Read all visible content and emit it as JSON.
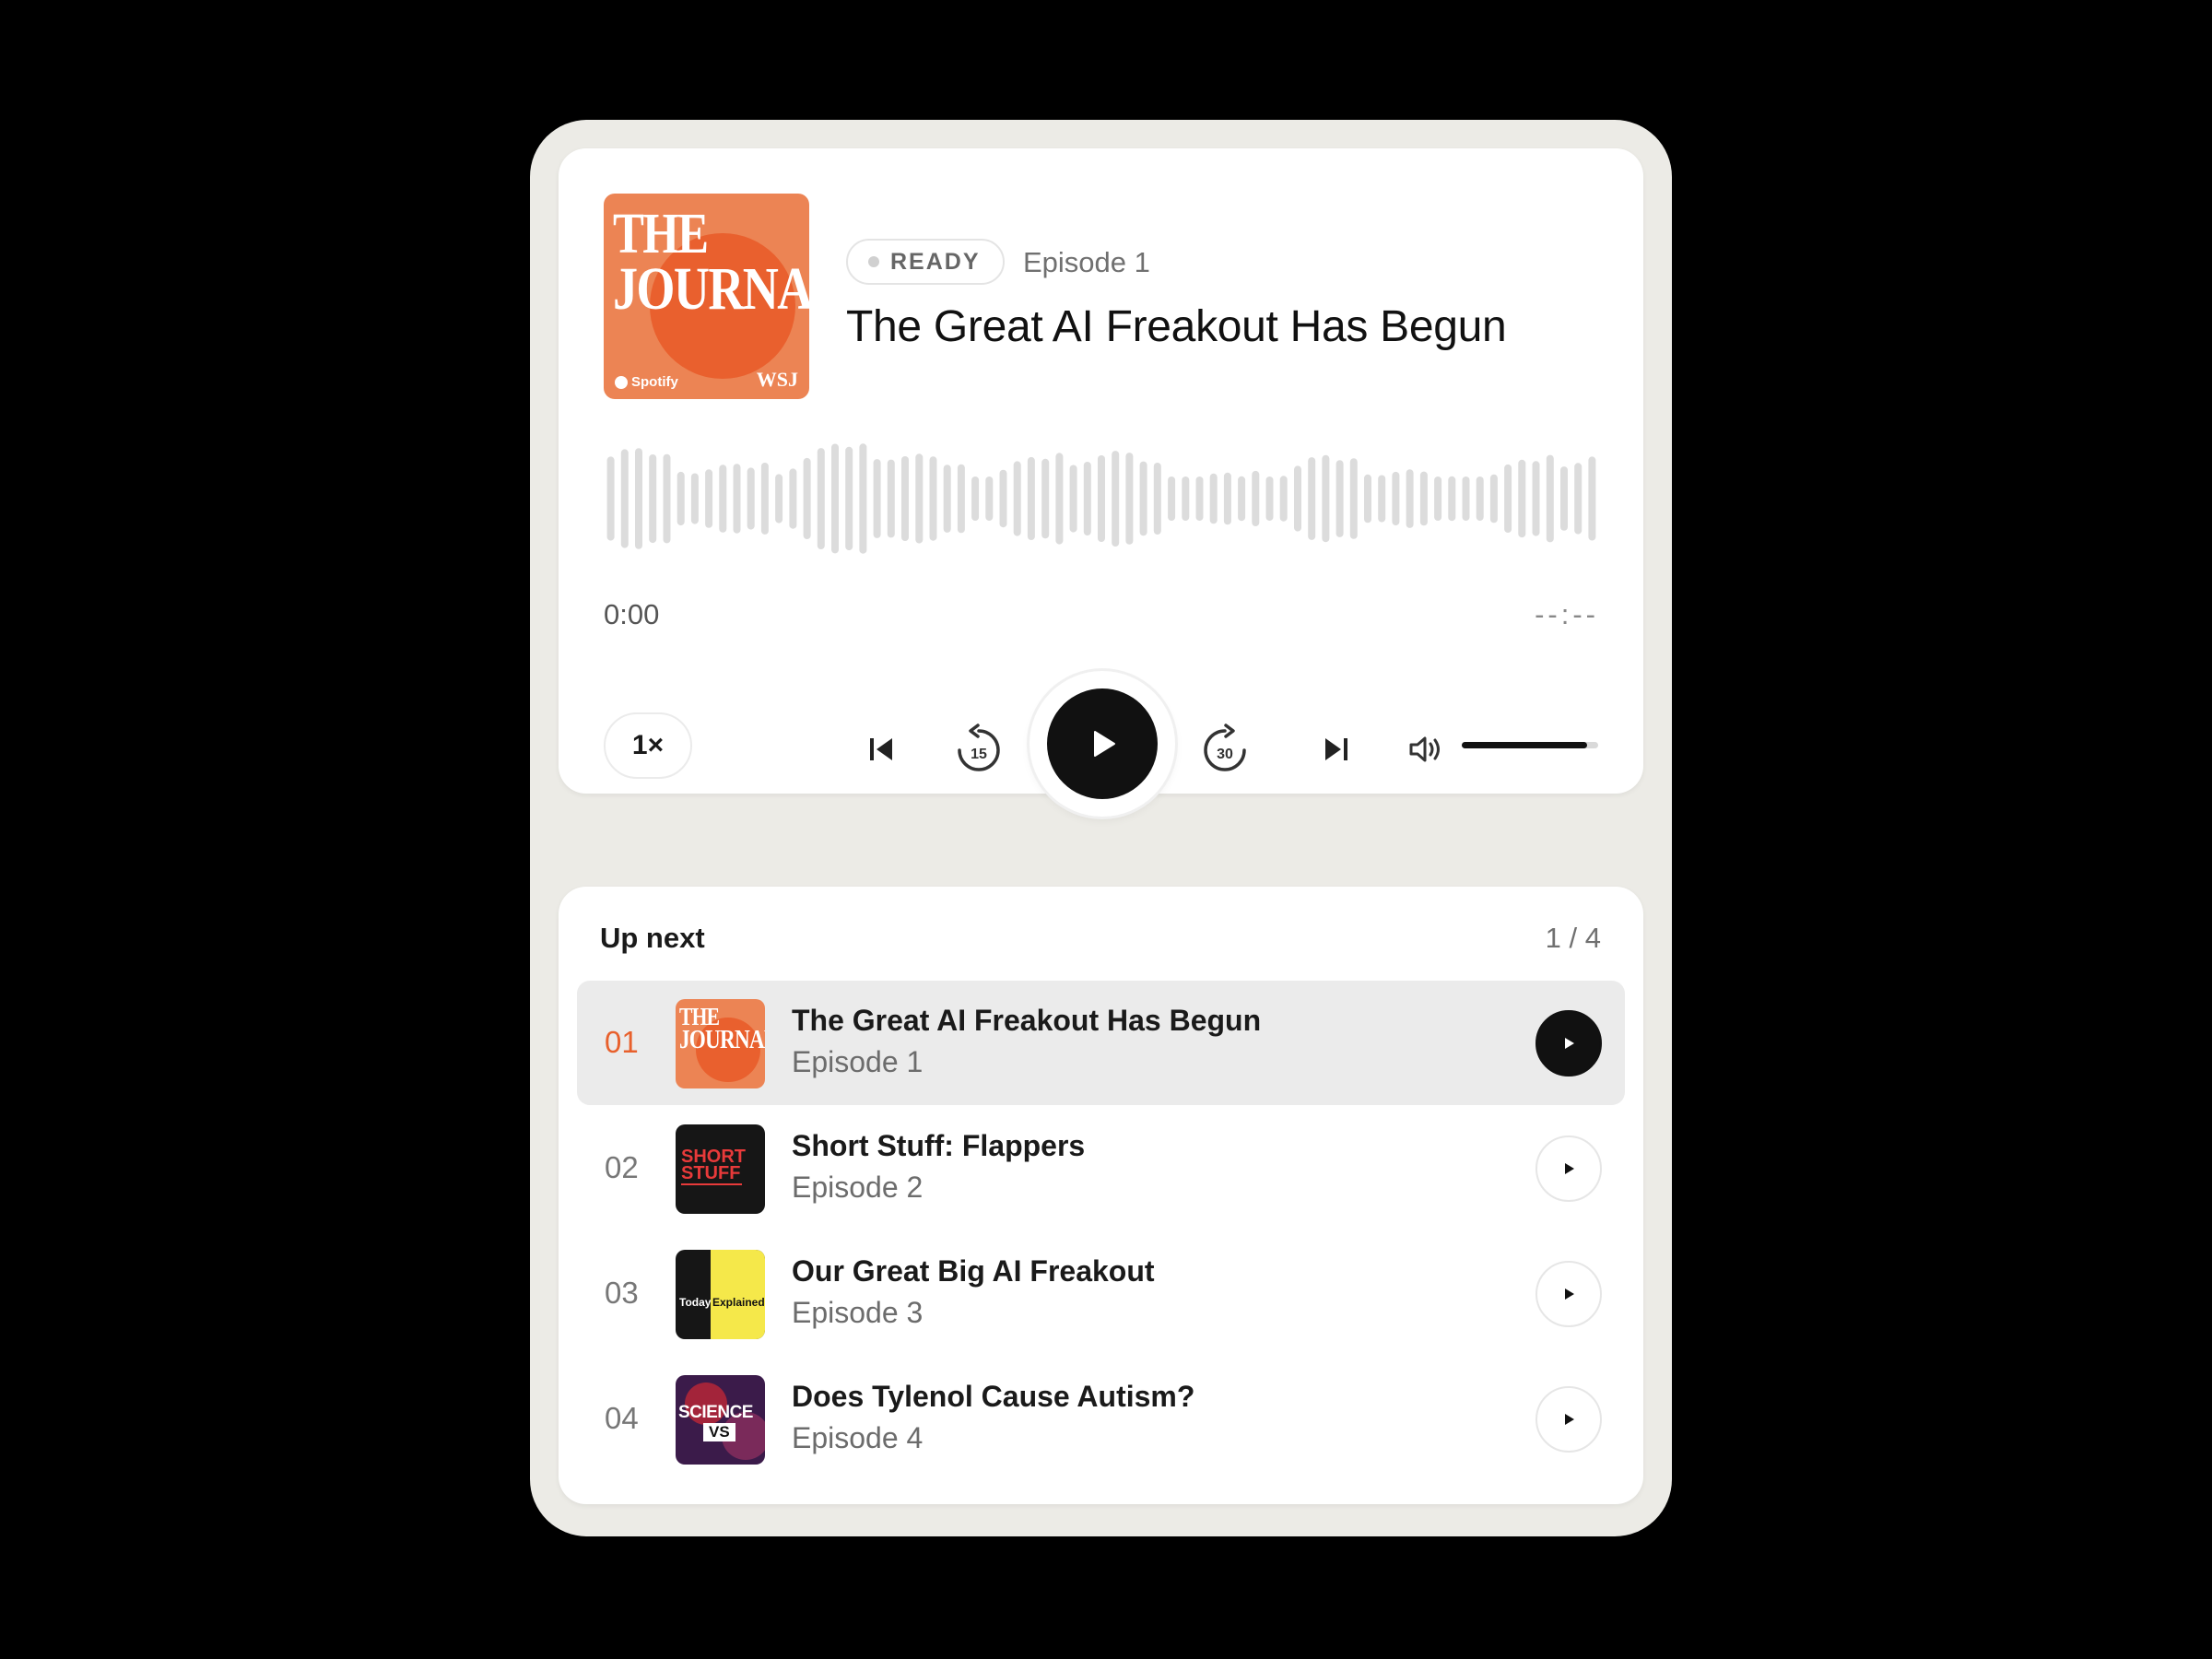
{
  "player": {
    "art": {
      "word1": "THE",
      "word2": "JOURNAL.",
      "brand": "Spotify",
      "publisher": "WSJ"
    },
    "status": "READY",
    "episode_label": "Episode 1",
    "title": "The Great AI Freakout Has Begun",
    "time_current": "0:00",
    "time_total": "--:--",
    "speed": "1×",
    "skip_back_seconds": "15",
    "skip_forward_seconds": "30",
    "volume": 0.92,
    "colors": {
      "accent": "#e8602c",
      "primary": "#111111"
    }
  },
  "queue": {
    "heading": "Up next",
    "position": "1 / 4",
    "items": [
      {
        "num": "01",
        "title": "The Great AI Freakout Has Begun",
        "subtitle": "Episode 1",
        "active": true,
        "thumb": {
          "w1": "THE",
          "w2": "JOURNAL."
        }
      },
      {
        "num": "02",
        "title": "Short Stuff: Flappers",
        "subtitle": "Episode 2",
        "active": false,
        "thumb": {
          "line1": "SHORT",
          "line2": "STUFF"
        }
      },
      {
        "num": "03",
        "title": "Our Great Big AI Freakout",
        "subtitle": "Episode 3",
        "active": false,
        "thumb": {
          "left": "Today",
          "right": "Explained"
        }
      },
      {
        "num": "04",
        "title": "Does Tylenol Cause Autism?",
        "subtitle": "Episode 4",
        "active": false,
        "thumb": {
          "top": "SCIENCE",
          "bottom": "VS"
        }
      }
    ]
  }
}
